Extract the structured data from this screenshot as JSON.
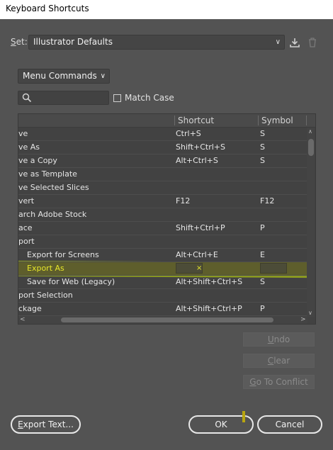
{
  "window": {
    "title": "Keyboard Shortcuts"
  },
  "set": {
    "label_u": "S",
    "label_rest": "et:",
    "value": "Illustrator Defaults"
  },
  "toolbar": {
    "save_icon": "save-set-icon",
    "delete_icon": "delete-set-icon"
  },
  "category": {
    "value": "Menu Commands"
  },
  "search": {
    "value": "",
    "placeholder": ""
  },
  "match_case": {
    "label": "Match Case",
    "checked": false
  },
  "table": {
    "columns": [
      "",
      "Shortcut",
      "Symbol"
    ],
    "rows": [
      {
        "name": "ve",
        "shortcut": "Ctrl+S",
        "symbol": "S",
        "indent": false
      },
      {
        "name": "ve As",
        "shortcut": "Shift+Ctrl+S",
        "symbol": "S",
        "indent": false
      },
      {
        "name": "ve a Copy",
        "shortcut": "Alt+Ctrl+S",
        "symbol": "S",
        "indent": false
      },
      {
        "name": "ve as Template",
        "shortcut": "",
        "symbol": "",
        "indent": false
      },
      {
        "name": "ve Selected Slices",
        "shortcut": "",
        "symbol": "",
        "indent": false
      },
      {
        "name": "vert",
        "shortcut": "F12",
        "symbol": "F12",
        "indent": false
      },
      {
        "name": "arch Adobe Stock",
        "shortcut": "",
        "symbol": "",
        "indent": false
      },
      {
        "name": "ace",
        "shortcut": "Shift+Ctrl+P",
        "symbol": "P",
        "indent": false
      },
      {
        "name": "port",
        "shortcut": "",
        "symbol": "",
        "indent": false
      },
      {
        "name": "Export for Screens",
        "shortcut": "Alt+Ctrl+E",
        "symbol": "E",
        "indent": true
      },
      {
        "name": "Export As",
        "shortcut": "×",
        "symbol": "",
        "indent": true,
        "selected": true
      },
      {
        "name": "Save for Web (Legacy)",
        "shortcut": "Alt+Shift+Ctrl+S",
        "symbol": "S",
        "indent": true
      },
      {
        "name": "port Selection",
        "shortcut": "",
        "symbol": "",
        "indent": false
      },
      {
        "name": "ckage",
        "shortcut": "Alt+Shift+Ctrl+P",
        "symbol": "P",
        "indent": false
      }
    ]
  },
  "side_buttons": {
    "undo": {
      "u": "U",
      "rest": "ndo"
    },
    "clear": {
      "u": "C",
      "rest": "lear"
    },
    "conflict": {
      "u": "G",
      "rest": "o To Conflict"
    }
  },
  "footer": {
    "export_u": "E",
    "export_rest": "xport Text...",
    "ok": "OK",
    "cancel": "Cancel"
  },
  "colors": {
    "background": "#535353",
    "selected_text": "#e6e62a",
    "highlight": "#97a81a"
  }
}
